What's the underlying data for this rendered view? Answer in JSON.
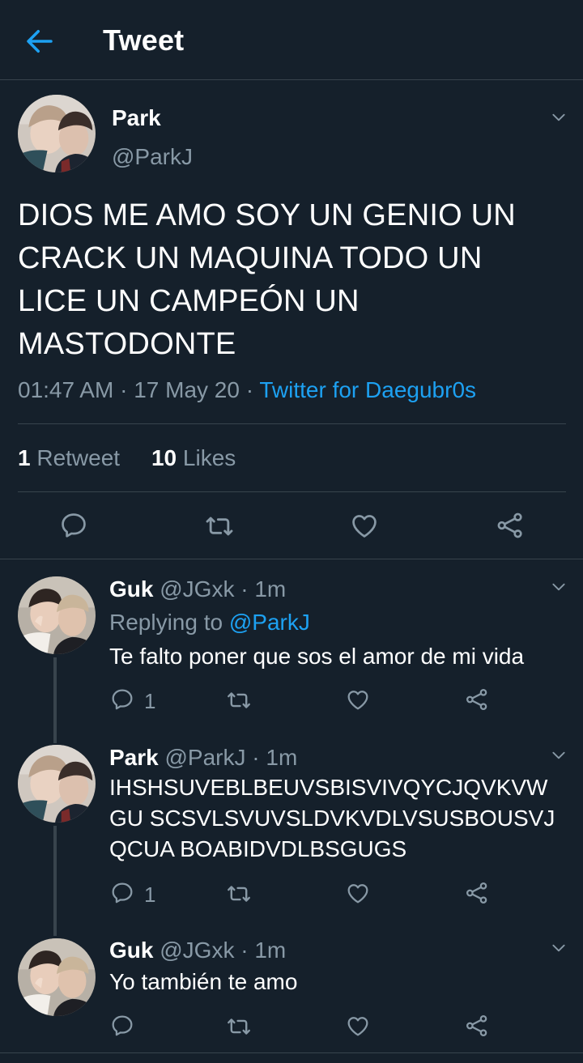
{
  "header": {
    "title": "Tweet",
    "back_icon": "arrow-left-icon",
    "accent": "#1da1f2"
  },
  "main_tweet": {
    "name": "Park",
    "handle": "@ParkJ",
    "text": "DIOS ME AMO SOY UN GENIO UN CRACK UN MAQUINA TODO UN LICE UN CAMPEÓN UN MASTODONTE",
    "time": "01:47 AM",
    "date": "17 May 20",
    "source": "Twitter for Daegubr0s",
    "retweets_count": "1",
    "retweets_label": "Retweet",
    "likes_count": "10",
    "likes_label": "Likes"
  },
  "replies": [
    {
      "name": "Guk",
      "meta": "@JGxk · 1m",
      "replying_prefix": "Replying to",
      "replying_to": "@ParkJ",
      "text": "Te falto poner que sos el amor de mi vida",
      "reply_count": "1"
    },
    {
      "name": "Park",
      "meta": "@ParkJ · 1m",
      "text": "IHSHSUVEBLBEUVSBISVIVQYCJQVKVWGU SCSVLSVUVSLDVKVDLVSUSBOUSVJQCUA BOABIDVDLBSGUGS",
      "reply_count": "1"
    },
    {
      "name": "Guk",
      "meta": "@JGxk · 1m",
      "text": "Yo también te amo"
    }
  ],
  "colors": {
    "background": "#15202b",
    "divider": "#38444d",
    "muted": "#8899a6",
    "link": "#1da1f2"
  }
}
